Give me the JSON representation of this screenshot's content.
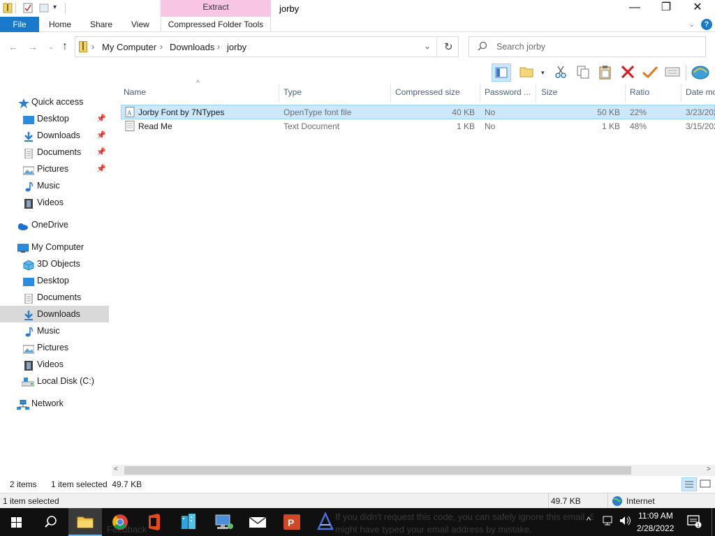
{
  "window": {
    "title": "jorby",
    "context_tab_header": "Extract",
    "controls": {
      "minimize": "—",
      "maximize": "❐",
      "close": "✕"
    }
  },
  "ribbon": {
    "tabs": [
      "File",
      "Home",
      "Share",
      "View"
    ],
    "context_tab": "Compressed Folder Tools"
  },
  "address": {
    "crumbs": [
      "My Computer",
      "Downloads",
      "jorby"
    ],
    "search_placeholder": "Search jorby"
  },
  "navpane": {
    "quick_access": "Quick access",
    "quick_items": [
      "Desktop",
      "Downloads",
      "Documents",
      "Pictures",
      "Music",
      "Videos"
    ],
    "onedrive": "OneDrive",
    "my_computer": "My Computer",
    "pc_items": [
      "3D Objects",
      "Desktop",
      "Documents",
      "Downloads",
      "Music",
      "Pictures",
      "Videos",
      "Local Disk (C:)"
    ],
    "network": "Network",
    "selected": "Downloads"
  },
  "columns": [
    "Name",
    "Type",
    "Compressed size",
    "Password ...",
    "Size",
    "Ratio",
    "Date mo"
  ],
  "files": [
    {
      "name": "Jorby Font by 7NTypes",
      "type": "OpenType font file",
      "compressed": "40 KB",
      "password": "No",
      "size": "50 KB",
      "ratio": "22%",
      "date": "3/23/202",
      "selected": true
    },
    {
      "name": "Read Me",
      "type": "Text Document",
      "compressed": "1 KB",
      "password": "No",
      "size": "1 KB",
      "ratio": "48%",
      "date": "3/15/202",
      "selected": false
    }
  ],
  "status": {
    "items": "2 items",
    "selected": "1 item selected  49.7 KB",
    "bottom_selected": "1 item selected",
    "bottom_size": "49.7 KB",
    "zone": "Internet"
  },
  "taskbar": {
    "time": "11:09 AM",
    "date": "2/28/2022",
    "notification_line1": "If you didn't request this code, you can safely ignore this email. Someone",
    "notification_line2": "might have typed your email address by mistake.",
    "notification_tag": "Feedback"
  },
  "colors": {
    "accent": "#1979ca",
    "extract_tab": "#f7c6e4",
    "selection": "#cce8ff",
    "taskbar": "#101010"
  }
}
